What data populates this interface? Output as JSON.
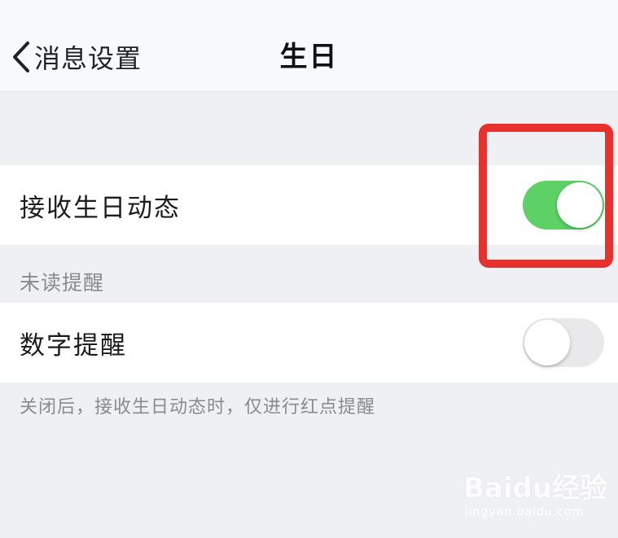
{
  "nav": {
    "back_label": "消息设置",
    "title": "生日"
  },
  "cells": {
    "receive_birthday": {
      "label": "接收生日动态",
      "enabled": true
    },
    "number_reminder": {
      "label": "数字提醒",
      "enabled": false
    }
  },
  "section": {
    "unread_header": "未读提醒",
    "footer_note": "关闭后，接收生日动态时，仅进行红点提醒"
  },
  "colors": {
    "switch_on": "#5dd066",
    "switch_off": "#e9e9eb",
    "highlight": "#e8302c"
  },
  "watermark": {
    "logo": "Baidu经验",
    "sub": "jingyan.baidu.com"
  }
}
